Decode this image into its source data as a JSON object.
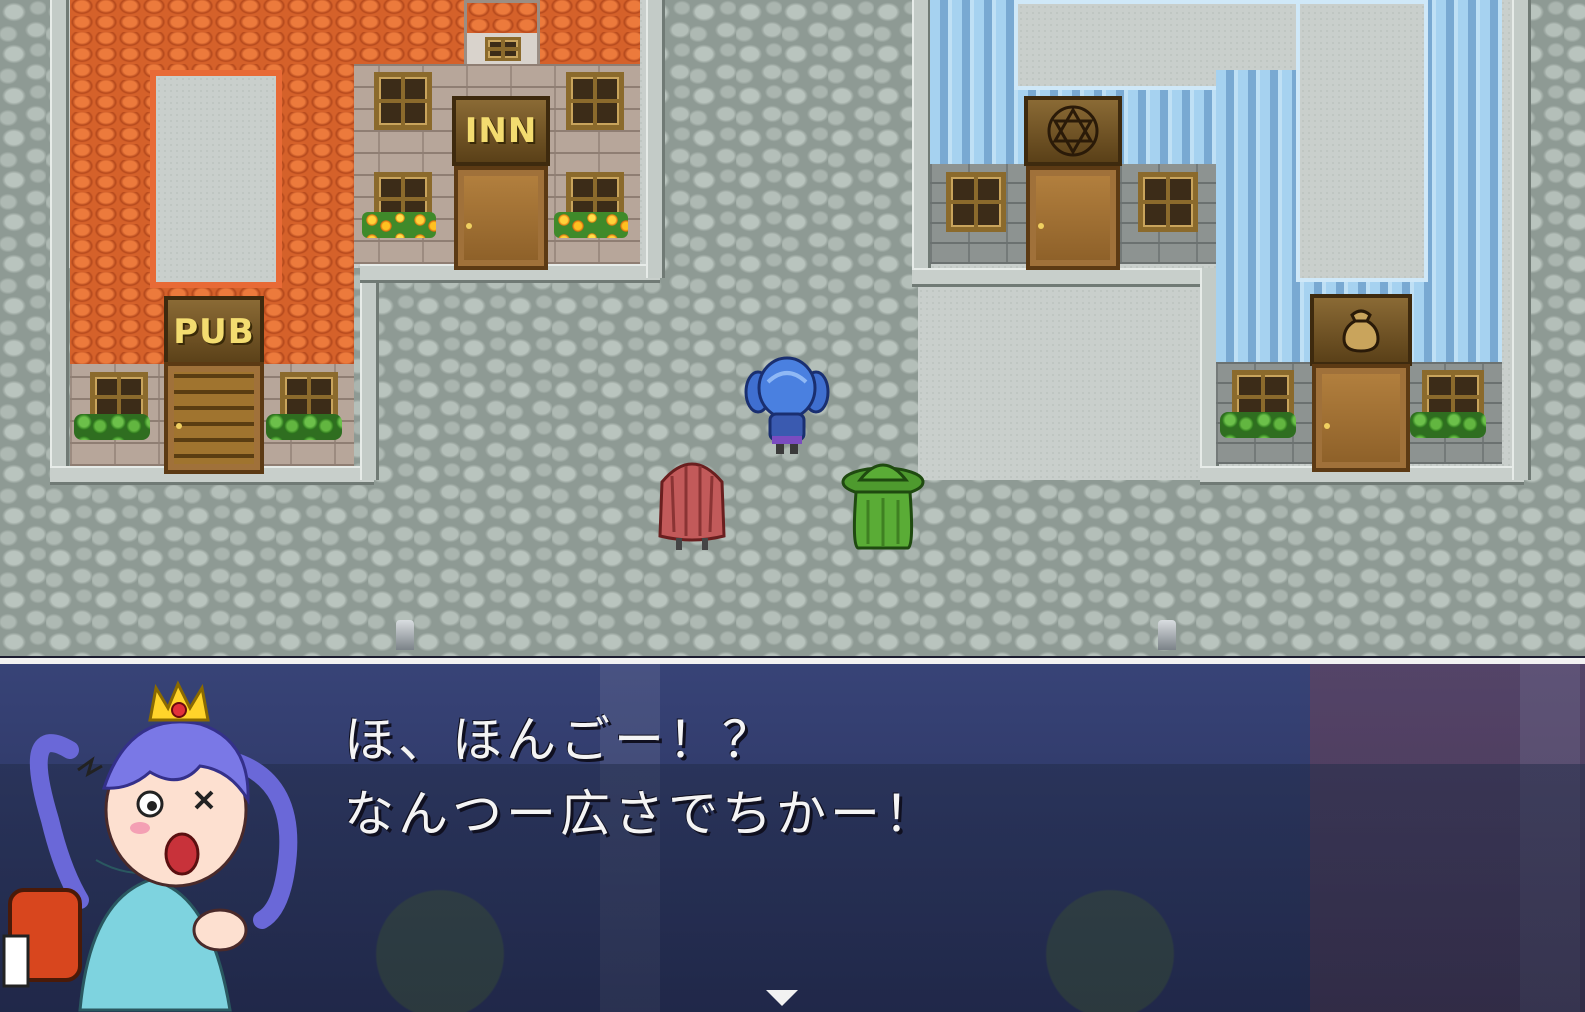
{
  "buildings": {
    "inn": {
      "sign": "INN"
    },
    "pub": {
      "sign": "PUB"
    },
    "magic_shop": {
      "sign_icon": "hexagram-icon"
    },
    "item_shop": {
      "sign_icon": "pot-bag-icon"
    }
  },
  "party": [
    "blue-haired-girl",
    "red-haired-girl",
    "green-hooded-mage"
  ],
  "dialogue": {
    "lines": [
      "ほ、ほんごー！？",
      "なんつー広さでちかー！"
    ],
    "speaker_portrait": "crowned-girl-portrait",
    "advance_indicator": "down-triangle-icon"
  },
  "colors": {
    "window_bg": "#27347a",
    "window_border": "#f2f2f2",
    "text": "#f4f4f4"
  }
}
